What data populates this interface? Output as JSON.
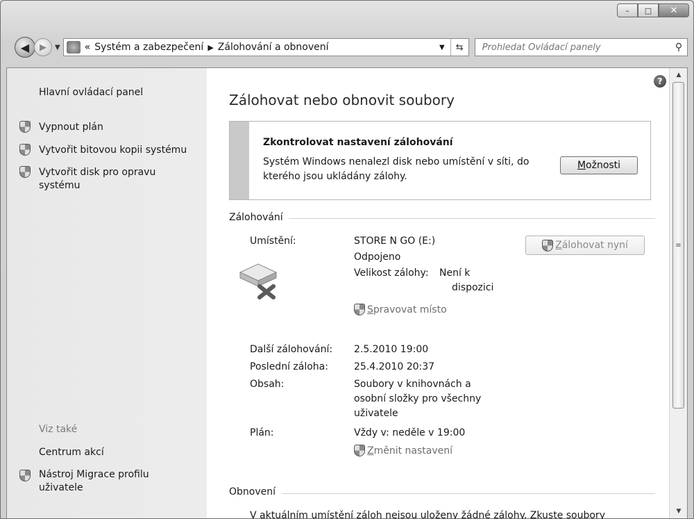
{
  "window": {
    "minimize": "–",
    "maximize": "□",
    "close": "✕"
  },
  "nav": {
    "breadcrumb_prefix": "«",
    "crumb1": "Systém a zabezpečení",
    "crumb2": "Zálohování a obnovení",
    "search_placeholder": "Prohledat Ovládací panely"
  },
  "sidebar": {
    "home": "Hlavní ovládací panel",
    "link1": "Vypnout plán",
    "link2": "Vytvořit bitovou kopii systému",
    "link3_line1": "Vytvořit disk pro opravu",
    "link3_line2": "systému",
    "see_also": "Viz také",
    "action_center": "Centrum akcí",
    "migration_line1": "Nástroj Migrace profilu",
    "migration_line2": "uživatele"
  },
  "main": {
    "title": "Zálohovat nebo obnovit soubory",
    "notice": {
      "title": "Zkontrolovat nastavení zálohování",
      "text": "Systém Windows nenalezl disk nebo umístění v síti, do kterého jsou ukládány zálohy.",
      "options_button_prefix": "M",
      "options_button_rest": "ožnosti"
    },
    "backup_group": "Zálohování",
    "location_label": "Umístění:",
    "location_value": "STORE N GO (E:)",
    "location_status": "Odpojeno",
    "size_label": "Velikost zálohy:",
    "size_value_line1": "Není k",
    "size_value_line2": "dispozici",
    "manage_prefix": "S",
    "manage_rest": "pravovat místo",
    "backup_now_prefix": "Z",
    "backup_now_rest": "álohovat nyní",
    "next_label": "Další zálohování:",
    "next_value": "2.5.2010 19:00",
    "last_label": "Poslední záloha:",
    "last_value": "25.4.2010 20:37",
    "content_label": "Obsah:",
    "content_line1": "Soubory v knihovnách a",
    "content_line2": "osobní složky pro všechny",
    "content_line3": "uživatele",
    "schedule_label": "Plán:",
    "schedule_value": "Vždy v: neděle v 19:00",
    "change_prefix": "Z",
    "change_rest": "měnit nastavení",
    "restore_group": "Obnovení",
    "restore_text": "V aktuálním umístění záloh nejsou uloženy žádné zálohy. Zkuste soubory"
  },
  "help": "?"
}
